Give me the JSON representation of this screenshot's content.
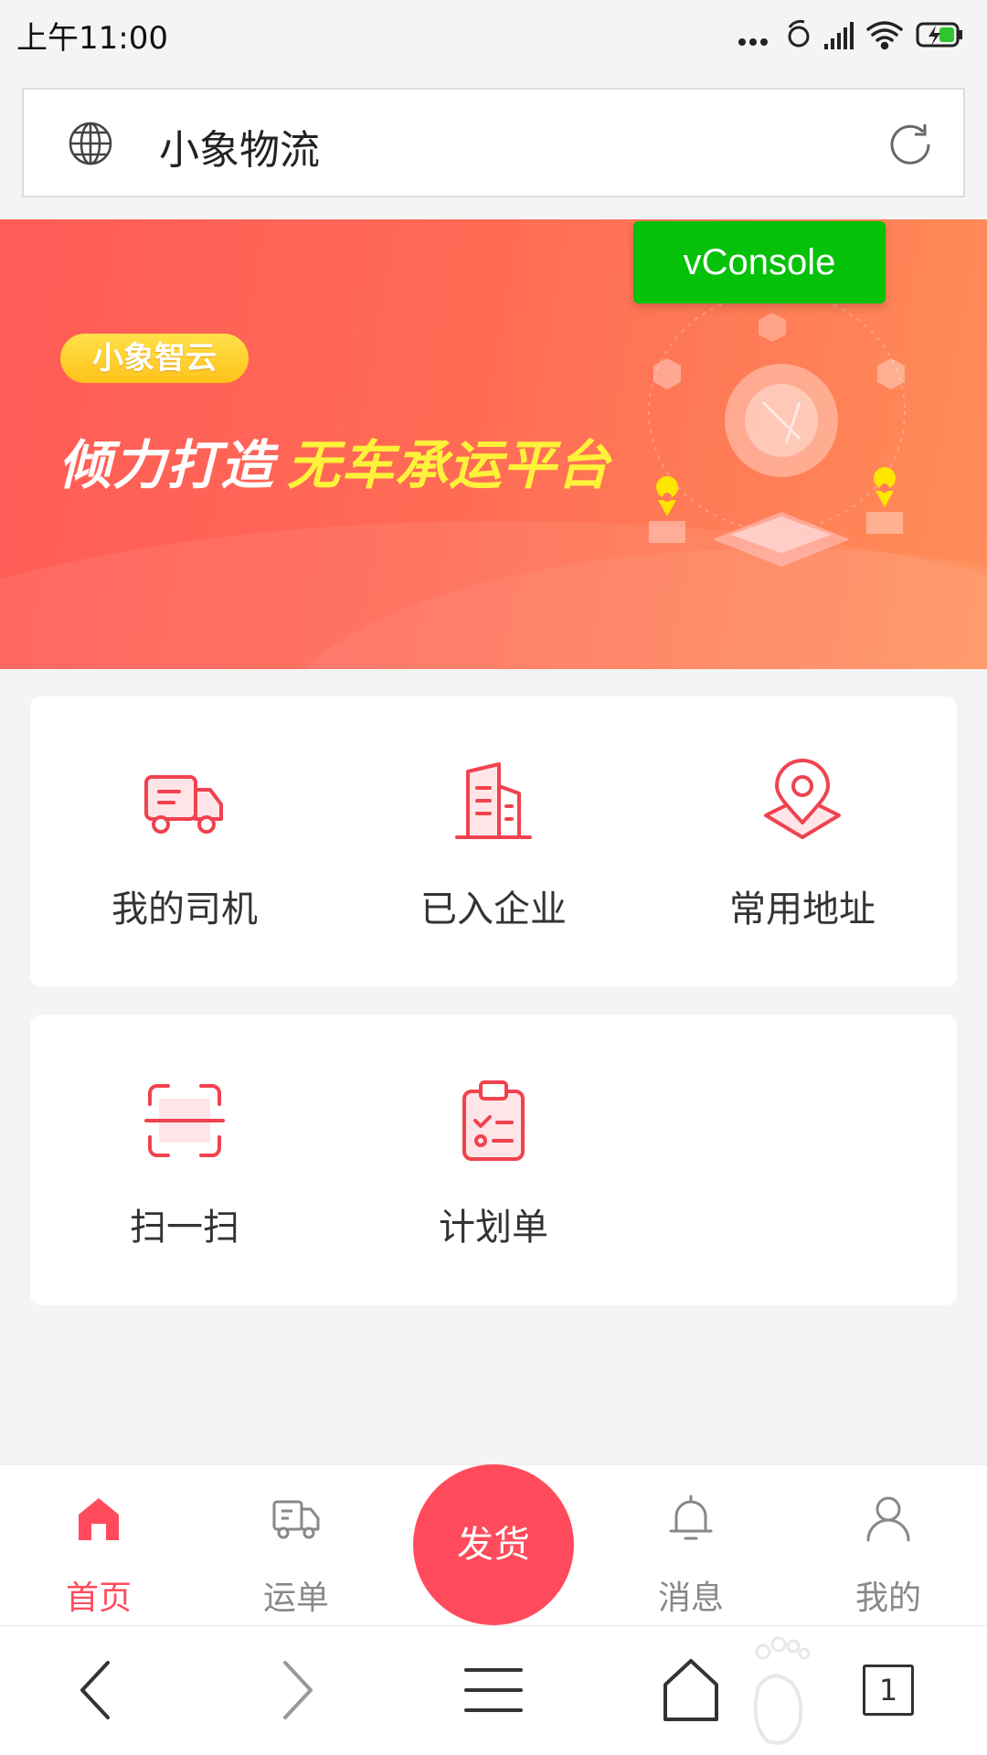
{
  "status_bar": {
    "time": "上午11:00"
  },
  "url_bar": {
    "title": "小象物流"
  },
  "banner": {
    "badge": "小象智云",
    "headline_white": "倾力打造",
    "headline_yellow": "无车承运平台"
  },
  "vconsole": {
    "label": "vConsole"
  },
  "grid_top": [
    {
      "label": "我的司机",
      "icon": "truck-icon"
    },
    {
      "label": "已入企业",
      "icon": "building-icon"
    },
    {
      "label": "常用地址",
      "icon": "location-pin-icon"
    }
  ],
  "grid_bottom": [
    {
      "label": "扫一扫",
      "icon": "scan-icon"
    },
    {
      "label": "计划单",
      "icon": "clipboard-icon"
    }
  ],
  "tab_bar": {
    "items": [
      {
        "label": "首页",
        "icon": "home-icon",
        "active": true
      },
      {
        "label": "运单",
        "icon": "truck-icon",
        "active": false
      },
      {
        "label": "消息",
        "icon": "bell-icon",
        "active": false
      },
      {
        "label": "我的",
        "icon": "user-icon",
        "active": false
      }
    ],
    "center_button": "发货"
  },
  "browser_nav": {
    "tab_count": "1"
  },
  "colors": {
    "accent": "#ff4b5b",
    "vconsole": "#05c10a",
    "banner_yellow": "#fff23a"
  }
}
